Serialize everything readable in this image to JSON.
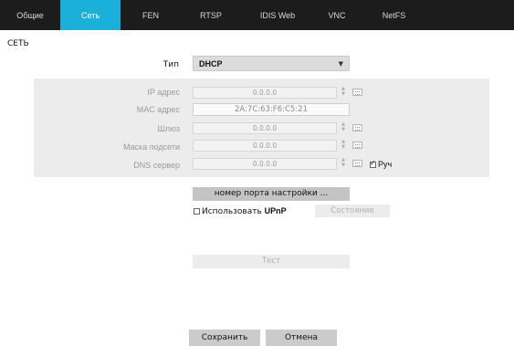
{
  "tabs": [
    {
      "label": "Общие",
      "active": false
    },
    {
      "label": "Сеть",
      "active": true
    },
    {
      "label": "FEN",
      "active": false
    },
    {
      "label": "RTSP",
      "active": false
    },
    {
      "label": "IDIS Web",
      "active": false
    },
    {
      "label": "VNC",
      "active": false
    },
    {
      "label": "NetFS",
      "active": false
    }
  ],
  "colors": {
    "tab_bar": "#1c1c1c",
    "tab_active": "#1ab0d9"
  },
  "section_title": "СЕТЬ",
  "type": {
    "label": "Тип",
    "value": "DHCP"
  },
  "fields": {
    "ip": {
      "label": "IP адрес",
      "value": "0.0.0.0"
    },
    "mac": {
      "label": "MAC адрес",
      "value": "2A:7C:63:F6:C5:21"
    },
    "gateway": {
      "label": "Шлюз",
      "value": "0.0.0.0"
    },
    "subnet": {
      "label": "Маска подсети",
      "value": "0.0.0.0"
    },
    "dns": {
      "label": "DNS сервер",
      "value": "0.0.0.0"
    }
  },
  "manual_checkbox": {
    "label": "Руч",
    "checked": true
  },
  "port_settings_button": "номер порта настройки ...",
  "upnp": {
    "prefix": "Использовать ",
    "bold": "UPnP",
    "checked": false
  },
  "status_button": "Состояние",
  "test_button": "Тест",
  "save_button": "Сохранить",
  "cancel_button": "Отмена",
  "icons": {
    "spinner": "spinner-arrows-icon",
    "keyboard": "keyboard-icon",
    "dropdown": "chevron-down-icon"
  }
}
